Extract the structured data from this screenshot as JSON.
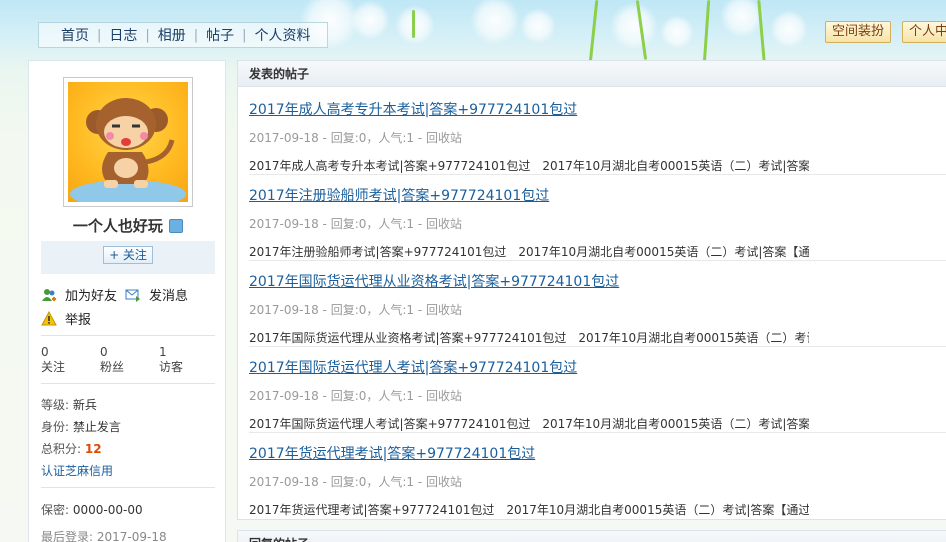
{
  "nav": {
    "items": [
      "首页",
      "日志",
      "相册",
      "帖子",
      "个人资料"
    ]
  },
  "top_buttons": {
    "decorate": "空间装扮",
    "center": "个人中"
  },
  "profile": {
    "nickname": "一个人也好玩",
    "follow_label": "+ 关注",
    "add_friend": "加为好友",
    "send_message": "发消息",
    "report": "举报",
    "stats": {
      "following_count": "0",
      "following_label": "关注",
      "fans_count": "0",
      "fans_label": "粉丝",
      "visitors_count": "1",
      "visitors_label": "访客"
    },
    "level_key": "等级:",
    "level_value": "新兵",
    "identity_key": "身份:",
    "identity_value": "禁止发言",
    "points_key": "总积分:",
    "points_value": "12",
    "verify_link": "认证芝麻信用",
    "secret_key": "保密:",
    "secret_value": "0000-00-00",
    "last_login_key": "最后登录:",
    "last_login_value": "2017-09-18"
  },
  "posts_section": {
    "title": "发表的帖子",
    "posts": [
      {
        "title": "2017年成人高考专升本考试|答案+977724101包过",
        "meta": "2017-09-18 - 回复:0，人气:1 - 回收站",
        "excerpt": "2017年成人高考专升本考试|答案+977724101包过　2017年10月湖北自考00015英语（二）考试|答案【"
      },
      {
        "title": "2017年注册验船师考试|答案+977724101包过",
        "meta": "2017-09-18 - 回复:0，人气:1 - 回收站",
        "excerpt": "2017年注册验船师考试|答案+977724101包过　2017年10月湖北自考00015英语（二）考试|答案【通过"
      },
      {
        "title": "2017年国际货运代理从业资格考试|答案+977724101包过",
        "meta": "2017-09-18 - 回复:0，人气:1 - 回收站",
        "excerpt": "2017年国际货运代理从业资格考试|答案+977724101包过　2017年10月湖北自考00015英语（二）考试|"
      },
      {
        "title": "2017年国际货运代理人考试|答案+977724101包过",
        "meta": "2017-09-18 - 回复:0，人气:1 - 回收站",
        "excerpt": "2017年国际货运代理人考试|答案+977724101包过　2017年10月湖北自考00015英语（二）考试|答案【"
      },
      {
        "title": "2017年货运代理考试|答案+977724101包过",
        "meta": "2017-09-18 - 回复:0，人气:1 - 回收站",
        "excerpt": "2017年货运代理考试|答案+977724101包过　2017年10月湖北自考00015英语（二）考试|答案【通过率"
      }
    ]
  },
  "second_section_title": "回复的帖子",
  "colors": {
    "link": "#1a5f9c",
    "score": "#e04a00",
    "nav_text": "#1d3f68"
  }
}
